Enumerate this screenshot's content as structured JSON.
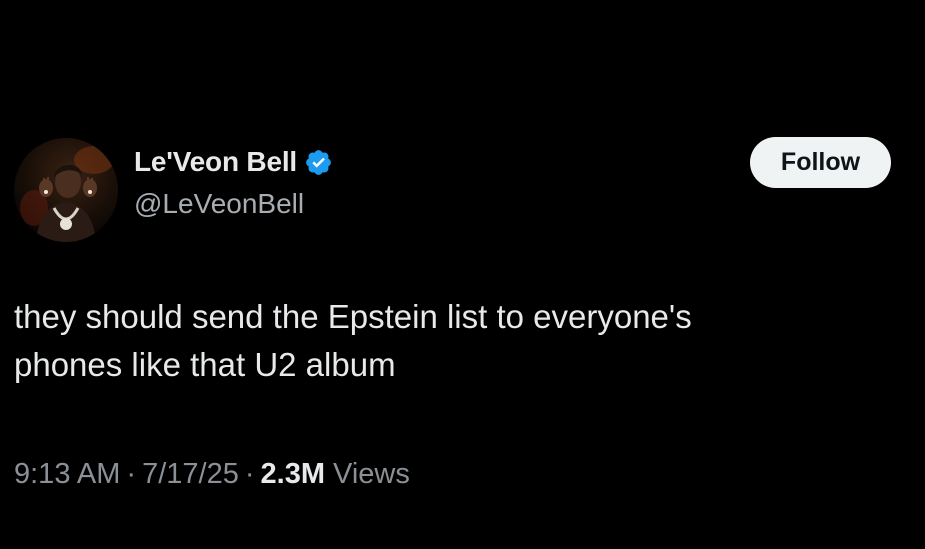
{
  "tweet": {
    "author": {
      "display_name": "Le'Veon Bell",
      "handle": "@LeVeonBell",
      "verified": true,
      "verified_color": "#1d9bf0",
      "avatar_icon": "profile-photo"
    },
    "follow_label": "Follow",
    "text_lines": [
      "they should send the Epstein list to everyone's",
      "phones like that U2 album"
    ],
    "meta": {
      "time": "9:13 AM",
      "separator": "·",
      "date": "7/17/25",
      "views_count": "2.3M",
      "views_label": "Views"
    }
  },
  "theme": {
    "background": "#000000",
    "primary_text": "#e7e9ea",
    "secondary_text": "#8b9096",
    "button_bg": "#eff3f4",
    "button_text": "#0f1419"
  }
}
